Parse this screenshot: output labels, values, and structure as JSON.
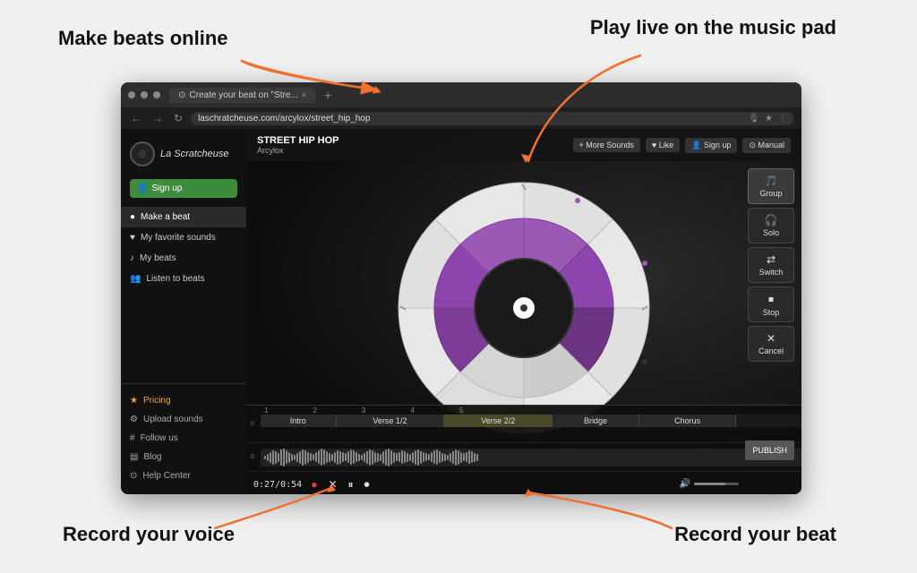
{
  "annotations": {
    "make_beats": "Make beats online",
    "play_live": "Play live on the music pad",
    "record_voice": "Record your voice",
    "record_beat": "Record your beat"
  },
  "browser": {
    "tab_title": "Create your beat on \"Stre...",
    "tab_plus": "+",
    "nav_back": "←",
    "nav_forward": "→",
    "nav_refresh": "↻",
    "address": "laschratcheuse.com/arcylox/street_hip_hop",
    "addr_mic": "🎙",
    "addr_star": "★",
    "addr_menu": "⋮"
  },
  "app": {
    "logo_text": "La Scratcheuse",
    "signup_btn": "Sign up",
    "track_title": "STREET HIP HOP",
    "track_artist": "Arcylox"
  },
  "sidebar": {
    "items": [
      {
        "label": "Make a beat",
        "icon": "●",
        "active": true
      },
      {
        "label": "My favorite sounds",
        "icon": "♥",
        "active": false
      },
      {
        "label": "My beats",
        "icon": "♪",
        "active": false
      },
      {
        "label": "Listen to beats",
        "icon": "👥",
        "active": false
      }
    ],
    "bottom_items": [
      {
        "label": "Pricing",
        "icon": "★",
        "class": "pricing"
      },
      {
        "label": "Upload sounds",
        "icon": "⚙",
        "class": ""
      },
      {
        "label": "Follow us",
        "icon": "#",
        "class": ""
      },
      {
        "label": "Blog",
        "icon": "▤",
        "class": ""
      },
      {
        "label": "Help Center",
        "icon": "⊙",
        "class": ""
      }
    ]
  },
  "topbar_buttons": [
    {
      "label": "More Sounds",
      "icon": "+"
    },
    {
      "label": "Like",
      "icon": "♥"
    },
    {
      "label": "Sign up",
      "icon": "👤"
    },
    {
      "label": "Manual",
      "icon": "⊙"
    }
  ],
  "right_panel": [
    {
      "label": "Group",
      "icon": "🎵",
      "active": true
    },
    {
      "label": "Solo",
      "icon": "🎧",
      "active": false
    },
    {
      "label": "Switch",
      "icon": "⇄",
      "active": false
    },
    {
      "label": "Stop",
      "icon": "⏹",
      "active": false
    },
    {
      "label": "Cancel",
      "icon": "✕",
      "active": false
    }
  ],
  "sections": [
    {
      "label": "Intro",
      "width": 14
    },
    {
      "label": "Verse 1/2",
      "width": 20
    },
    {
      "label": "Verse 2/2",
      "width": 20
    },
    {
      "label": "Bridge",
      "width": 16
    },
    {
      "label": "Chorus",
      "width": 18
    }
  ],
  "transport": {
    "time": "0:27/0:54",
    "publish": "PUBLISH"
  }
}
